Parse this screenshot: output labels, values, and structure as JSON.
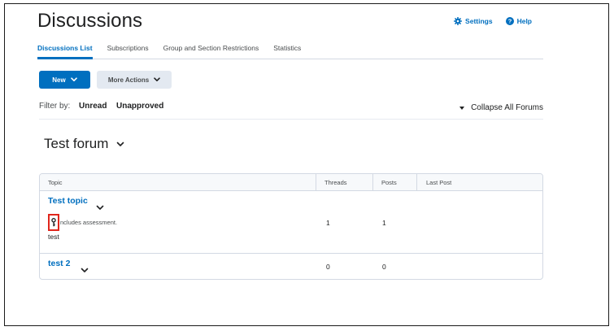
{
  "page": {
    "title": "Discussions",
    "settings_label": "Settings",
    "help_label": "Help"
  },
  "tabs": [
    {
      "label": "Discussions List",
      "active": true
    },
    {
      "label": "Subscriptions",
      "active": false
    },
    {
      "label": "Group and Section Restrictions",
      "active": false
    },
    {
      "label": "Statistics",
      "active": false
    }
  ],
  "toolbar": {
    "new_label": "New",
    "more_actions_label": "More Actions"
  },
  "filter": {
    "label": "Filter by:",
    "unread": "Unread",
    "unapproved": "Unapproved",
    "collapse_all": "Collapse All Forums"
  },
  "forum": {
    "title": "Test forum",
    "columns": {
      "topic": "Topic",
      "threads": "Threads",
      "posts": "Posts",
      "last_post": "Last Post"
    },
    "topics": [
      {
        "title": "Test topic",
        "note": "ncludes assessment.",
        "description": "test",
        "threads": "1",
        "posts": "1",
        "last_post": ""
      },
      {
        "title": "test 2",
        "threads": "0",
        "posts": "0",
        "last_post": ""
      }
    ]
  },
  "colors": {
    "link": "#006fbf",
    "primary_button": "#006fbf",
    "secondary_button": "#e3e9f1",
    "highlight": "#e0261c"
  },
  "icons": {
    "settings": "gear-icon",
    "help": "question-icon",
    "dropdown": "chevron-down-icon",
    "assessment": "key-icon"
  }
}
